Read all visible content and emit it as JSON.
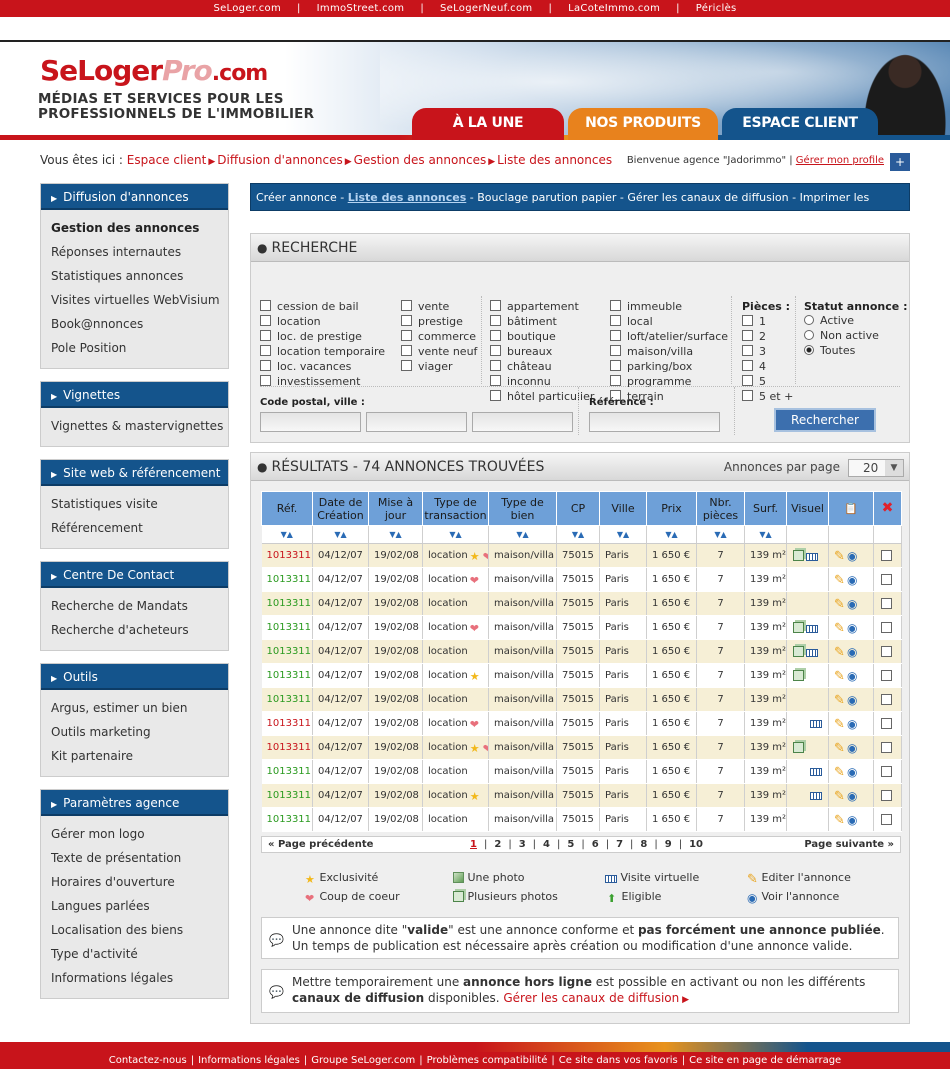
{
  "topbar": {
    "links": [
      "SeLoger.com",
      "ImmoStreet.com",
      "SeLogerNeuf.com",
      "LaCoteImmo.com",
      "Périclès"
    ],
    "separator": "|"
  },
  "header": {
    "logo_a": "SeLoger",
    "logo_b": "Pro",
    "logo_c": ".com",
    "tagline_1": "MÉDIAS ET SERVICES POUR LES",
    "tagline_2": "PROFESSIONNELS DE L'IMMOBILIER",
    "tabs": [
      {
        "label": "À LA UNE",
        "color": "#c8141b"
      },
      {
        "label": "NOS PRODUITS",
        "color": "#e8821d"
      },
      {
        "label": "ESPACE CLIENT",
        "color": "#14548c"
      }
    ]
  },
  "breadcrumb": {
    "prefix": "Vous êtes ici :",
    "items": [
      "Espace client",
      "Diffusion d'annonces",
      "Gestion des annonces",
      "Liste des annonces"
    ]
  },
  "welcome": {
    "text": "Bienvenue agence \"Jadorimmo\"",
    "sep": "|",
    "link": "Gérer mon profile",
    "plus": "+"
  },
  "sidebar": [
    {
      "title": "Diffusion d'annonces",
      "items": [
        {
          "label": "Gestion des annonces",
          "bold": true
        },
        {
          "label": "Réponses internautes"
        },
        {
          "label": "Statistiques annonces"
        },
        {
          "label": "Visites virtuelles WebVisium"
        },
        {
          "label": "Book@nnonces"
        },
        {
          "label": "Pole Position"
        }
      ]
    },
    {
      "title": "Vignettes",
      "items": [
        {
          "label": "Vignettes & mastervignettes"
        }
      ]
    },
    {
      "title": "Site web & référencement",
      "items": [
        {
          "label": "Statistiques visite"
        },
        {
          "label": "Référencement"
        }
      ]
    },
    {
      "title": "Centre De Contact",
      "items": [
        {
          "label": "Recherche de Mandats"
        },
        {
          "label": "Recherche d'acheteurs"
        }
      ]
    },
    {
      "title": "Outils",
      "items": [
        {
          "label": "Argus, estimer un bien"
        },
        {
          "label": "Outils marketing"
        },
        {
          "label": "Kit partenaire"
        }
      ]
    },
    {
      "title": "Paramètres agence",
      "items": [
        {
          "label": "Gérer mon logo"
        },
        {
          "label": "Texte de présentation"
        },
        {
          "label": "Horaires d'ouverture"
        },
        {
          "label": "Langues parlées"
        },
        {
          "label": "Localisation des biens"
        },
        {
          "label": "Type d'activité"
        },
        {
          "label": "Informations légales"
        }
      ]
    }
  ],
  "subnav": {
    "items": [
      "Créer annonce",
      "Liste des annonces",
      "Bouclage parution papier",
      "Gérer les canaux de diffusion",
      "Imprimer les certificats de parution"
    ],
    "current": 1,
    "sep": " - "
  },
  "search": {
    "title": "RECHERCHE",
    "col1": [
      "cession de bail",
      "location",
      "loc. de prestige",
      "location temporaire",
      "loc. vacances",
      "investissement"
    ],
    "col2": [
      "vente",
      "prestige",
      "commerce",
      "vente neuf",
      "viager"
    ],
    "col3": [
      "appartement",
      "bâtiment",
      "boutique",
      "bureaux",
      "château",
      "inconnu",
      "hôtel particulier"
    ],
    "col4": [
      "immeuble",
      "local",
      "loft/atelier/surface",
      "maison/villa",
      "parking/box",
      "programme",
      "terrain"
    ],
    "pieces_label": "Pièces :",
    "pieces": [
      "1",
      "2",
      "3",
      "4",
      "5",
      "5 et +"
    ],
    "statut_label": "Statut annonce :",
    "statut": [
      "Active",
      "Non active",
      "Toutes"
    ],
    "statut_selected": 2,
    "cp_label": "Code postal, ville :",
    "ref_label": "Référence :",
    "button": "Rechercher"
  },
  "results": {
    "title": "RÉSULTATS - 74 ANNONCES TROUVÉES",
    "per_page_label": "Annonces par page",
    "per_page": "20",
    "columns": [
      "Réf.",
      "Date de Création",
      "Mise à jour",
      "Type de transaction",
      "Type de bien",
      "CP",
      "Ville",
      "Prix",
      "Nbr. pièces",
      "Surf.",
      "Visuel"
    ],
    "sort_glyph": "▼▲",
    "rows": [
      {
        "ref": "1013311",
        "rc": "r",
        "created": "04/12/07",
        "updated": "19/02/08",
        "trans": "location",
        "star": true,
        "heart": true,
        "bien": "maison/villa",
        "cp": "75015",
        "ville": "Paris",
        "prix": "1 650 €",
        "pieces": "7",
        "surf": "139 m²",
        "photos": true,
        "vis": true
      },
      {
        "ref": "1013311",
        "rc": "g",
        "created": "04/12/07",
        "updated": "19/02/08",
        "trans": "location",
        "heart": true,
        "bien": "maison/villa",
        "cp": "75015",
        "ville": "Paris",
        "prix": "1 650 €",
        "pieces": "7",
        "surf": "139 m²"
      },
      {
        "ref": "1013311",
        "rc": "g",
        "created": "04/12/07",
        "updated": "19/02/08",
        "trans": "location",
        "bien": "maison/villa",
        "cp": "75015",
        "ville": "Paris",
        "prix": "1 650 €",
        "pieces": "7",
        "surf": "139 m²"
      },
      {
        "ref": "1013311",
        "rc": "g",
        "created": "04/12/07",
        "updated": "19/02/08",
        "trans": "location",
        "heart": true,
        "bien": "maison/villa",
        "cp": "75015",
        "ville": "Paris",
        "prix": "1 650 €",
        "pieces": "7",
        "surf": "139 m²",
        "photos": true,
        "vis": true
      },
      {
        "ref": "1013311",
        "rc": "g",
        "created": "04/12/07",
        "updated": "19/02/08",
        "trans": "location",
        "bien": "maison/villa",
        "cp": "75015",
        "ville": "Paris",
        "prix": "1 650 €",
        "pieces": "7",
        "surf": "139 m²",
        "photos": true,
        "vis": true
      },
      {
        "ref": "1013311",
        "rc": "g",
        "created": "04/12/07",
        "updated": "19/02/08",
        "trans": "location",
        "star": true,
        "bien": "maison/villa",
        "cp": "75015",
        "ville": "Paris",
        "prix": "1 650 €",
        "pieces": "7",
        "surf": "139 m²",
        "photos": true
      },
      {
        "ref": "1013311",
        "rc": "g",
        "created": "04/12/07",
        "updated": "19/02/08",
        "trans": "location",
        "bien": "maison/villa",
        "cp": "75015",
        "ville": "Paris",
        "prix": "1 650 €",
        "pieces": "7",
        "surf": "139 m²"
      },
      {
        "ref": "1013311",
        "rc": "r",
        "created": "04/12/07",
        "updated": "19/02/08",
        "trans": "location",
        "heart": true,
        "bien": "maison/villa",
        "cp": "75015",
        "ville": "Paris",
        "prix": "1 650 €",
        "pieces": "7",
        "surf": "139 m²",
        "vis": true
      },
      {
        "ref": "1013311",
        "rc": "r",
        "created": "04/12/07",
        "updated": "19/02/08",
        "trans": "location",
        "star": true,
        "heart": true,
        "bien": "maison/villa",
        "cp": "75015",
        "ville": "Paris",
        "prix": "1 650 €",
        "pieces": "7",
        "surf": "139 m²",
        "photos": true
      },
      {
        "ref": "1013311",
        "rc": "g",
        "created": "04/12/07",
        "updated": "19/02/08",
        "trans": "location",
        "bien": "maison/villa",
        "cp": "75015",
        "ville": "Paris",
        "prix": "1 650 €",
        "pieces": "7",
        "surf": "139 m²",
        "vis": true
      },
      {
        "ref": "1013311",
        "rc": "g",
        "created": "04/12/07",
        "updated": "19/02/08",
        "trans": "location",
        "star": true,
        "bien": "maison/villa",
        "cp": "75015",
        "ville": "Paris",
        "prix": "1 650 €",
        "pieces": "7",
        "surf": "139 m²",
        "vis": true
      },
      {
        "ref": "1013311",
        "rc": "g",
        "created": "04/12/07",
        "updated": "19/02/08",
        "trans": "location",
        "bien": "maison/villa",
        "cp": "75015",
        "ville": "Paris",
        "prix": "1 650 €",
        "pieces": "7",
        "surf": "139 m²"
      }
    ],
    "pager": {
      "prev": "« Page précédente",
      "next": "Page suivante »",
      "pages": [
        "1",
        "2",
        "3",
        "4",
        "5",
        "6",
        "7",
        "8",
        "9",
        "10"
      ],
      "current": "1",
      "sep": "|"
    }
  },
  "legend": {
    "exclusivite": "Exclusivité",
    "coup": "Coup de coeur",
    "photo": "Une photo",
    "photos": "Plusieurs photos",
    "visite": "Visite virtuelle",
    "eligible": "Eligible",
    "editer": "Editer l'annonce",
    "voir": "Voir l'annonce"
  },
  "notes": {
    "n1_a": "Une annonce dite \"",
    "n1_b": "valide",
    "n1_c": "\" est une annonce conforme et ",
    "n1_d": "pas forcément une annonce publiée",
    "n1_e": ". Un temps de publication est nécessaire après création ou modification d'une annonce valide.",
    "n2_a": "Mettre temporairement une ",
    "n2_b": "annonce hors ligne",
    "n2_c": " est possible en activant ou non les différents ",
    "n2_d": "canaux de diffusion",
    "n2_e": " disponibles. ",
    "n2_link": "Gérer les canaux de diffusion"
  },
  "footer": {
    "links": [
      "Contactez-nous",
      "Informations légales",
      "Groupe SeLoger.com",
      "Problèmes compatibilité",
      "Ce site dans vos favoris",
      "Ce site en page de démarrage"
    ],
    "sep": "|"
  },
  "colors": {
    "red": "#c8141b",
    "blue": "#14548c",
    "orange": "#e8821d"
  }
}
